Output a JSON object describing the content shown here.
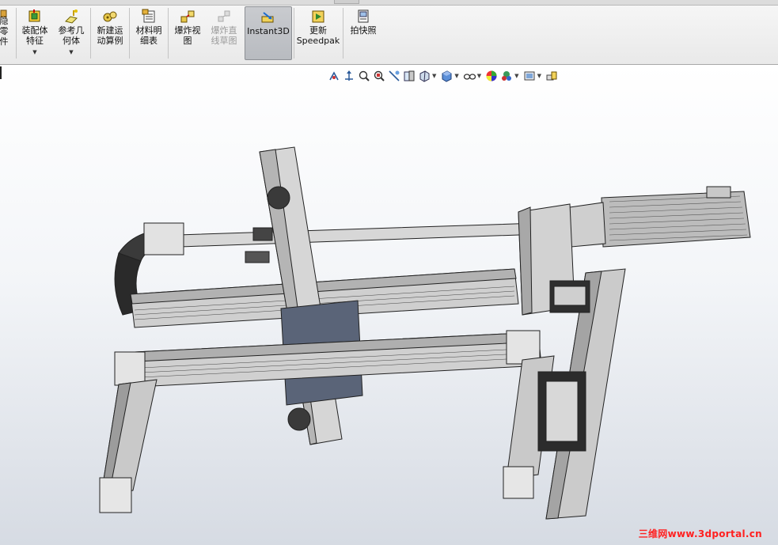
{
  "ribbon": {
    "partial_left_label": "隐\n零\n件",
    "buttons": [
      {
        "key": "assembly_feature",
        "label": "装配体\n特征",
        "icon": "assembly-feature-icon",
        "has_dropdown": true,
        "state": "normal"
      },
      {
        "key": "reference_geometry",
        "label": "参考几\n何体",
        "icon": "reference-geometry-icon",
        "has_dropdown": true,
        "state": "normal"
      },
      {
        "key": "new_motion_study",
        "label": "新建运\n动算例",
        "icon": "motion-study-icon",
        "has_dropdown": false,
        "state": "normal"
      },
      {
        "key": "bill_of_materials",
        "label": "材料明\n细表",
        "icon": "bill-of-materials-icon",
        "has_dropdown": false,
        "state": "normal"
      },
      {
        "key": "exploded_view",
        "label": "爆炸视\n图",
        "icon": "exploded-view-icon",
        "has_dropdown": false,
        "state": "normal"
      },
      {
        "key": "explode_line_sketch",
        "label": "爆炸直\n线草图",
        "icon": "explode-line-sketch-icon",
        "has_dropdown": false,
        "state": "disabled"
      },
      {
        "key": "instant3d",
        "label": "Instant3D",
        "icon": "instant3d-icon",
        "has_dropdown": false,
        "state": "active"
      },
      {
        "key": "update_speedpak",
        "label": "更新\nSpeedpak",
        "icon": "speedpak-icon",
        "has_dropdown": false,
        "state": "normal"
      },
      {
        "key": "take_snapshot",
        "label": "拍快照",
        "icon": "snapshot-icon",
        "has_dropdown": false,
        "state": "normal"
      }
    ]
  },
  "heads_up_toolbar": {
    "items": [
      {
        "icon": "zoom-to-fit-icon"
      },
      {
        "icon": "zoom-to-area-icon"
      },
      {
        "icon": "previous-view-icon"
      },
      {
        "icon": "zoom-in-out-icon"
      },
      {
        "icon": "section-view-icon"
      },
      {
        "icon": "dynamic-annotation-icon"
      },
      {
        "icon": "view-orientation-icon",
        "dropdown": true
      },
      {
        "icon": "display-style-icon",
        "dropdown": true
      },
      {
        "icon": "hide-show-items-icon",
        "dropdown": true
      },
      {
        "icon": "edit-appearance-icon"
      },
      {
        "icon": "apply-scene-icon",
        "dropdown": true
      },
      {
        "icon": "view-settings-icon",
        "dropdown": true
      },
      {
        "icon": "display-pane-icon"
      }
    ]
  },
  "viewport": {
    "content": "assembly-3d-model",
    "watermark": "三维网www.3dportal.cn",
    "watermark_color": "#ff2020"
  },
  "colors": {
    "ribbon_bg": "#ececec",
    "active_button_bg": "#bfc1c5",
    "viewport_top": "#ffffff",
    "viewport_bottom": "#d6dbe3"
  }
}
